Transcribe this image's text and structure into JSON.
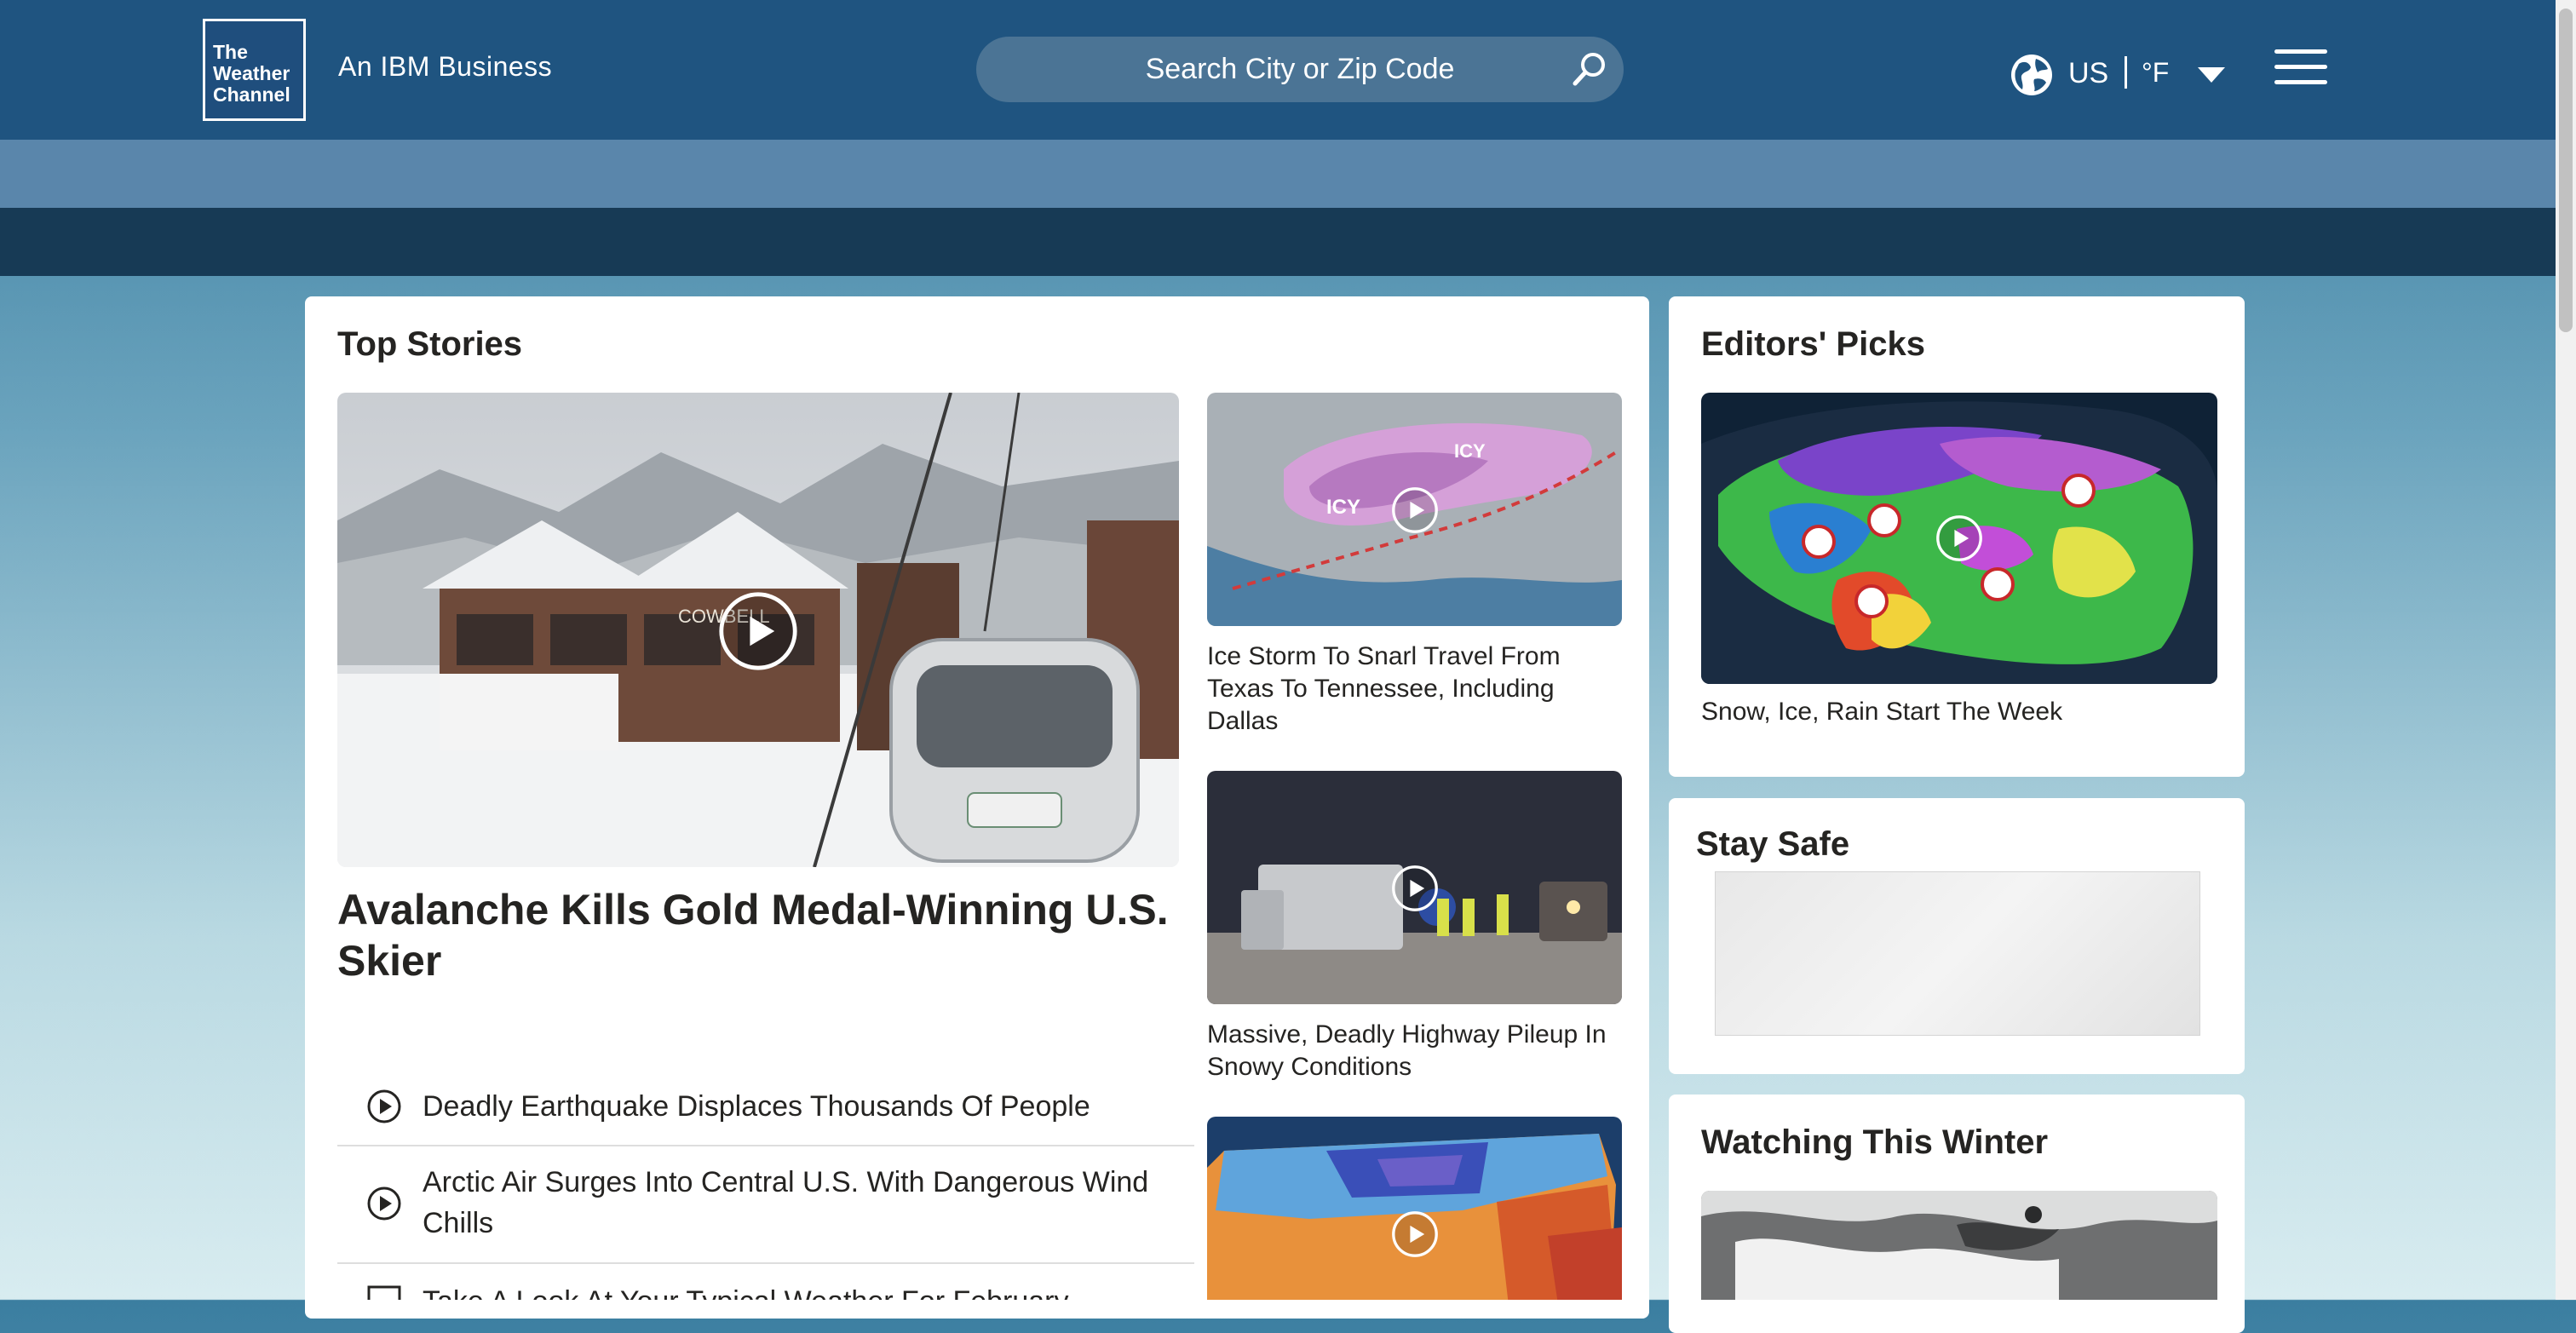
{
  "header": {
    "logo_lines": [
      "The",
      "Weather",
      "Channel"
    ],
    "tagline": "An IBM Business",
    "search": {
      "placeholder": "Search City or Zip Code"
    },
    "locale": {
      "country": "US",
      "unit": "°F"
    }
  },
  "top_stories": {
    "title": "Top Stories",
    "feature": {
      "headline": "Avalanche Kills Gold Medal-Winning U.S. Skier",
      "image_sign": "COWBELL"
    },
    "side_stories": [
      {
        "caption": "Ice Storm To Snarl Travel From Texas To Tennessee, Including Dallas",
        "map_label": "ICY"
      },
      {
        "caption": "Massive, Deadly Highway Pileup In Snowy Conditions"
      },
      {
        "caption": ""
      }
    ],
    "list": [
      {
        "text": "Deadly Earthquake Displaces Thousands Of People",
        "icon": "play-circle-icon"
      },
      {
        "text": "Arctic Air Surges Into Central U.S. With Dangerous Wind Chills",
        "icon": "play-circle-icon"
      },
      {
        "text": "Take A Look At Your Typical Weather For February",
        "icon": "article-icon"
      }
    ]
  },
  "editors_picks": {
    "title": "Editors' Picks",
    "caption": "Snow, Ice, Rain Start The Week"
  },
  "stay_safe": {
    "title": "Stay Safe"
  },
  "watching_winter": {
    "title": "Watching This Winter"
  },
  "colors": {
    "header_bg": "#1f5480",
    "subbar_light": "#5a86ab",
    "subbar_dark": "#173a55",
    "card_bg": "#ffffff",
    "text": "#252422"
  }
}
